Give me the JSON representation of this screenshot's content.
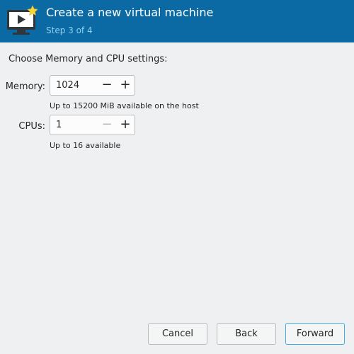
{
  "header": {
    "title": "Create a new virtual machine",
    "step": "Step 3 of 4",
    "icon": "virtual-machine-new-icon"
  },
  "main": {
    "section_title": "Choose Memory and CPU settings:",
    "memory": {
      "label": "Memory:",
      "value": "1024",
      "hint": "Up to 15200 MiB available on the host"
    },
    "cpus": {
      "label": "CPUs:",
      "value": "1",
      "hint": "Up to 16 available"
    }
  },
  "buttons": {
    "cancel": "Cancel",
    "back": "Back",
    "forward": "Forward"
  },
  "colors": {
    "header_bg": "#0b6aa3",
    "step_text": "#8fd0f0",
    "focus_accent": "#3daee9",
    "window_bg": "#eff0f1"
  }
}
